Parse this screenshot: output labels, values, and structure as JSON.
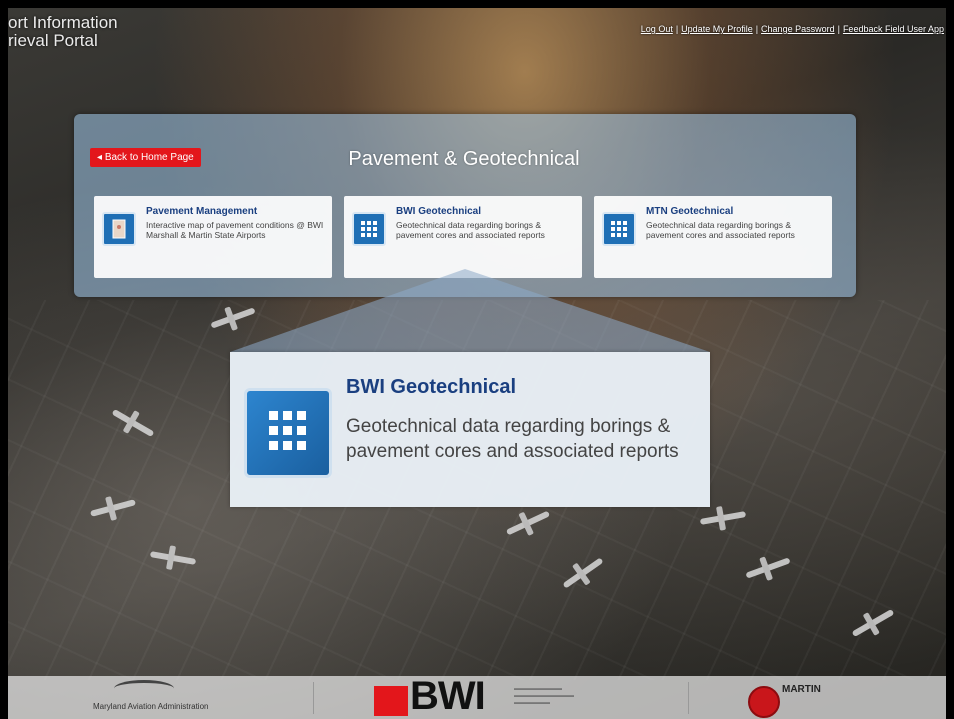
{
  "header": {
    "site_title": "ort Information\nrieval Portal",
    "links": [
      "Log Out",
      "Update My Profile",
      "Change Password",
      "Feedback Field User App"
    ]
  },
  "panel": {
    "back_button": "Back to Home Page",
    "title": "Pavement & Geotechnical",
    "cards": [
      {
        "title": "Pavement Management",
        "description": "Interactive map of pavement conditions @ BWI Marshall & Martin State Airports",
        "icon": "map-icon"
      },
      {
        "title": "BWI Geotechnical",
        "description": "Geotechnical data regarding borings & pavement cores and associated reports",
        "icon": "grid-dots-icon"
      },
      {
        "title": "MTN Geotechnical",
        "description": "Geotechnical data regarding borings & pavement cores and associated reports",
        "icon": "grid-dots-icon"
      }
    ]
  },
  "zoom_callout": {
    "title": "BWI Geotechnical",
    "description": "Geotechnical data regarding borings & pavement cores and associated reports"
  },
  "footer": {
    "mda_text": "Maryland Aviation Administration",
    "bwi_text": "BWI",
    "martin_text": "MARTIN"
  },
  "colors": {
    "back_button": "#e3161b",
    "card_title": "#1a3f80",
    "icon_blue": "#1f6fb5"
  }
}
